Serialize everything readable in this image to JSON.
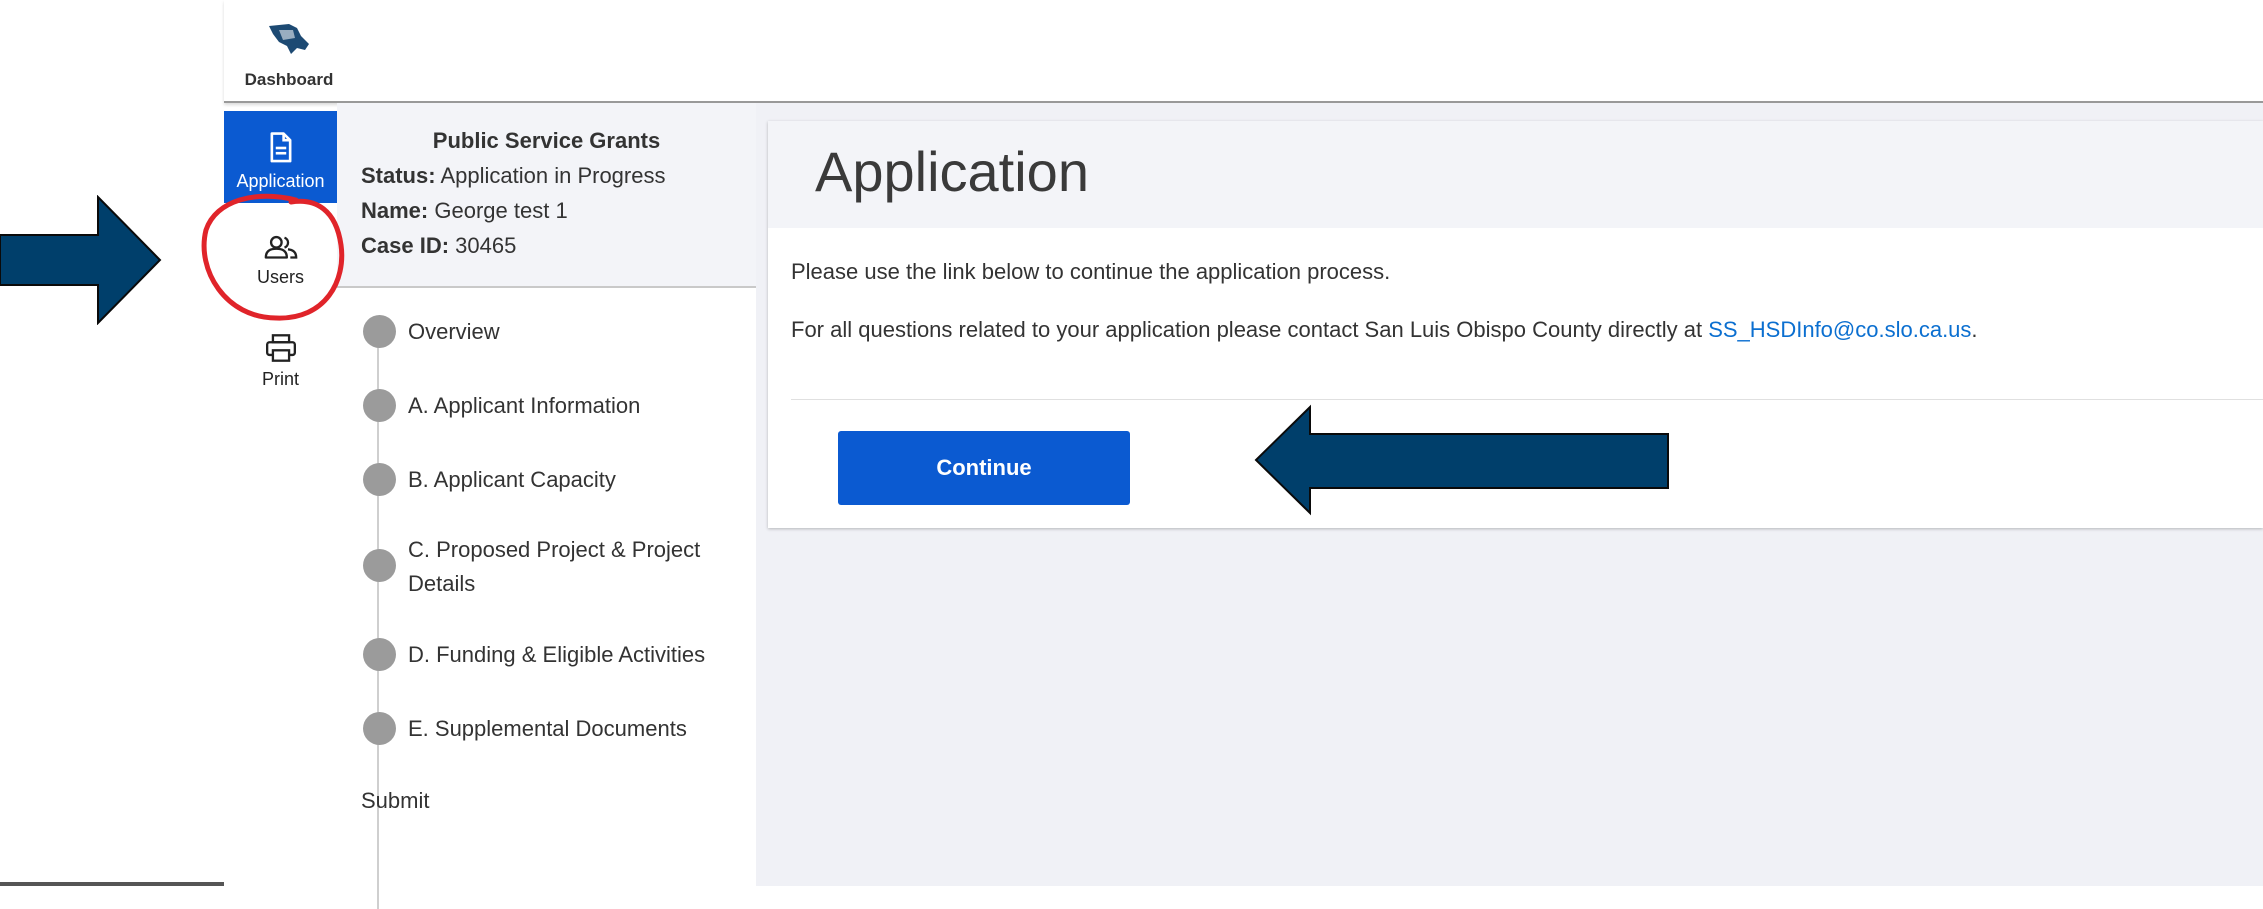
{
  "header": {
    "dashboard_label": "Dashboard"
  },
  "rail": [
    {
      "label": "Application",
      "icon": "document-icon",
      "active": true
    },
    {
      "label": "Users",
      "icon": "users-icon",
      "active": false
    },
    {
      "label": "Print",
      "icon": "printer-icon",
      "active": false
    }
  ],
  "grant": {
    "title": "Public Service Grants",
    "status_key": "Status:",
    "status_value": "Application in Progress",
    "name_key": "Name:",
    "name_value": "George test 1",
    "case_key": "Case ID:",
    "case_value": "30465"
  },
  "steps": [
    "Overview",
    "A. Applicant Information",
    "B. Applicant Capacity",
    "C. Proposed Project & Project",
    "Details",
    "D. Funding & Eligible Activities",
    "E. Supplemental Documents",
    "Submit"
  ],
  "main": {
    "title": "Application",
    "message_1": "Please use the link below to continue the application process.",
    "message_2_prefix": "For all questions related to your application please contact San Luis Obispo County directly at ",
    "email": "SS_HSDInfo@co.slo.ca.us",
    "message_2_suffix": ".",
    "continue_label": "Continue"
  },
  "colors": {
    "accent": "#0b5ad1",
    "arrow": "#003f6b",
    "highlight": "#e0242a",
    "link": "#0b6fd0"
  }
}
